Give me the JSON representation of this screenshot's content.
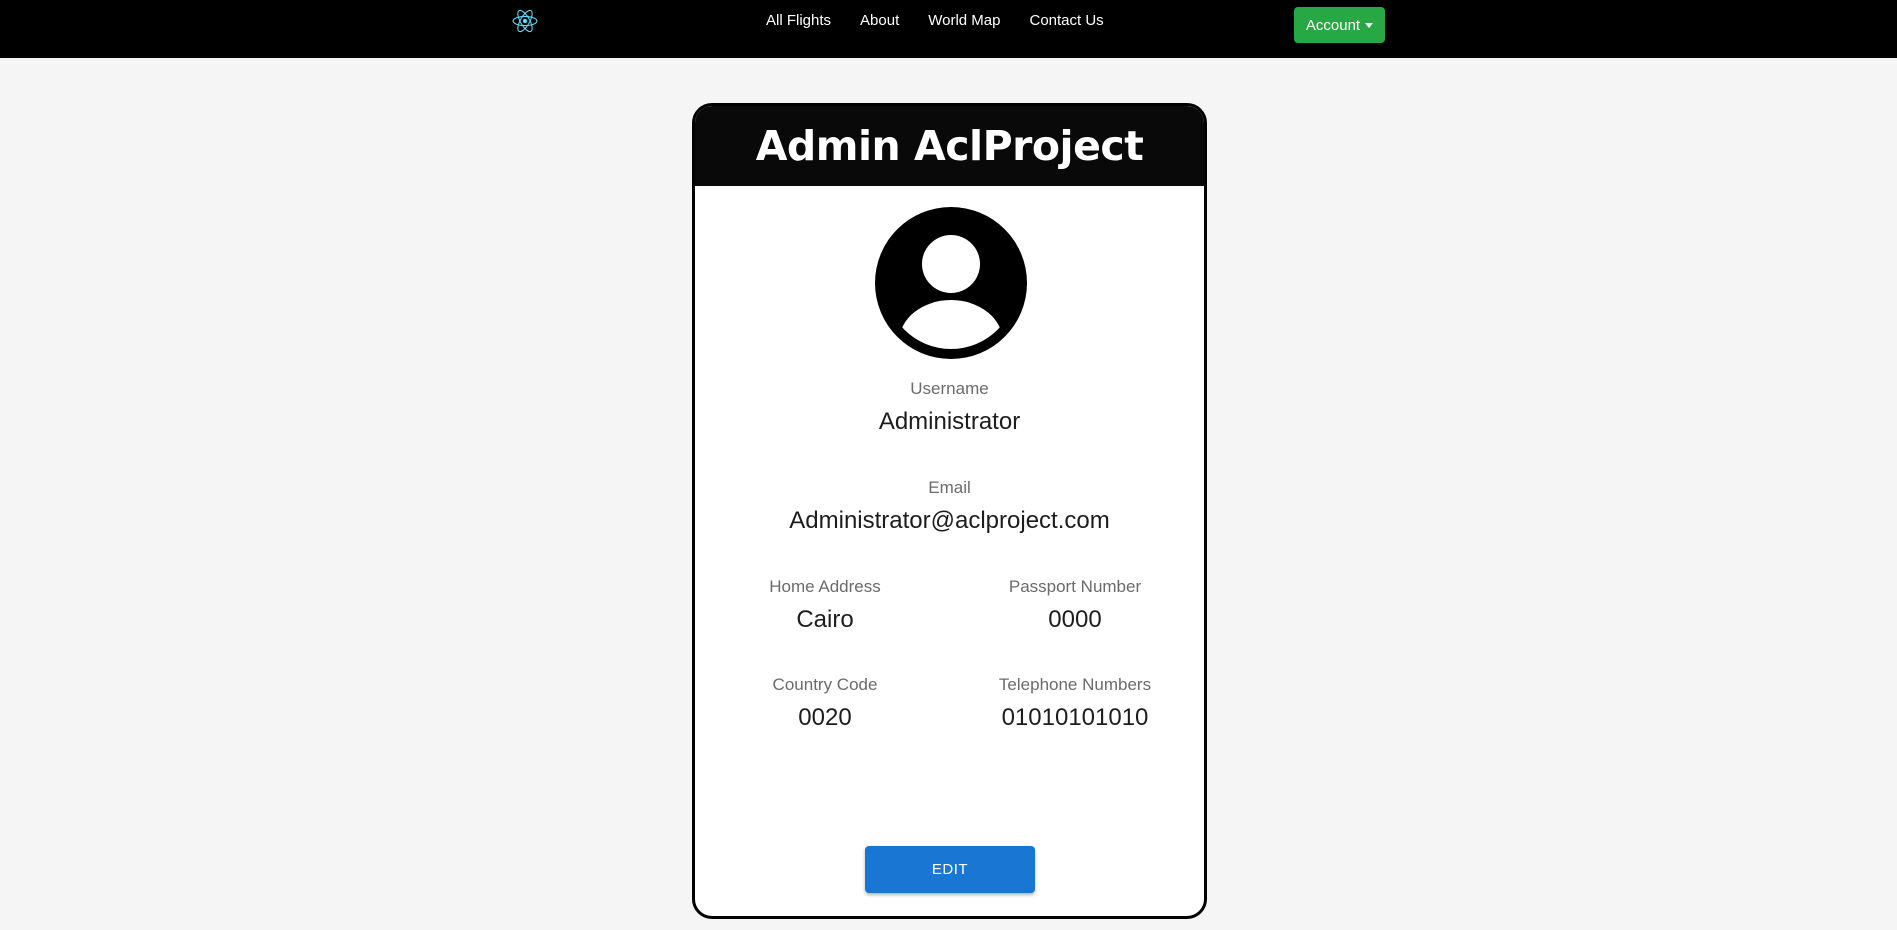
{
  "nav": {
    "logo_icon": "react-atom-icon",
    "links": [
      "All Flights",
      "About",
      "World Map",
      "Contact Us"
    ],
    "account_label": "Account"
  },
  "profile": {
    "title": "Admin AclProject",
    "avatar_icon": "user-avatar-icon",
    "username_label": "Username",
    "username": "Administrator",
    "email_label": "Email",
    "email": "Administrator@aclproject.com",
    "home_address_label": "Home Address",
    "home_address": "Cairo",
    "passport_label": "Passport Number",
    "passport": "0000",
    "country_code_label": "Country Code",
    "country_code": "0020",
    "telephone_label": "Telephone Numbers",
    "telephone": "01010101010",
    "edit_label": "EDIT"
  },
  "colors": {
    "navbar_bg": "#000000",
    "account_button": "#28a745",
    "edit_button": "#1976d2",
    "page_bg": "#f6f5f5",
    "logo": "#61dafb"
  }
}
